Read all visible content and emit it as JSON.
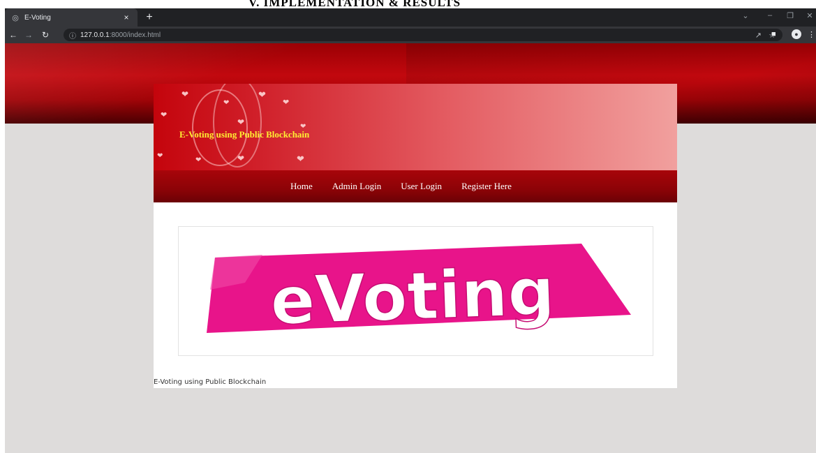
{
  "doc_caption": "V.      IMPLEMENTATION & RESULTS",
  "browser": {
    "tab_title": "E-Voting",
    "tab_close": "×",
    "new_tab": "+",
    "url_host": "127.0.0.1",
    "url_rest": ":8000/index.html"
  },
  "site": {
    "banner_title": "E-Voting using Public Blockchain",
    "menu": [
      "Home",
      "Admin Login",
      "User Login",
      "Register Here"
    ],
    "logo_text": "eVoting",
    "footer_text": "E-Voting using Public Blockchain"
  },
  "colors": {
    "logo_pink": "#e8148a",
    "banner_title": "#ffee33"
  },
  "icons": {
    "tab_favicon": "globe-icon",
    "back": "arrow-left-icon",
    "forward": "arrow-right-icon",
    "reload": "reload-icon",
    "site_info": "info-icon",
    "share": "share-icon",
    "bookmark": "star-icon",
    "side_panel": "sidepanel-icon",
    "profile": "profile-icon",
    "menu": "kebab-icon"
  }
}
